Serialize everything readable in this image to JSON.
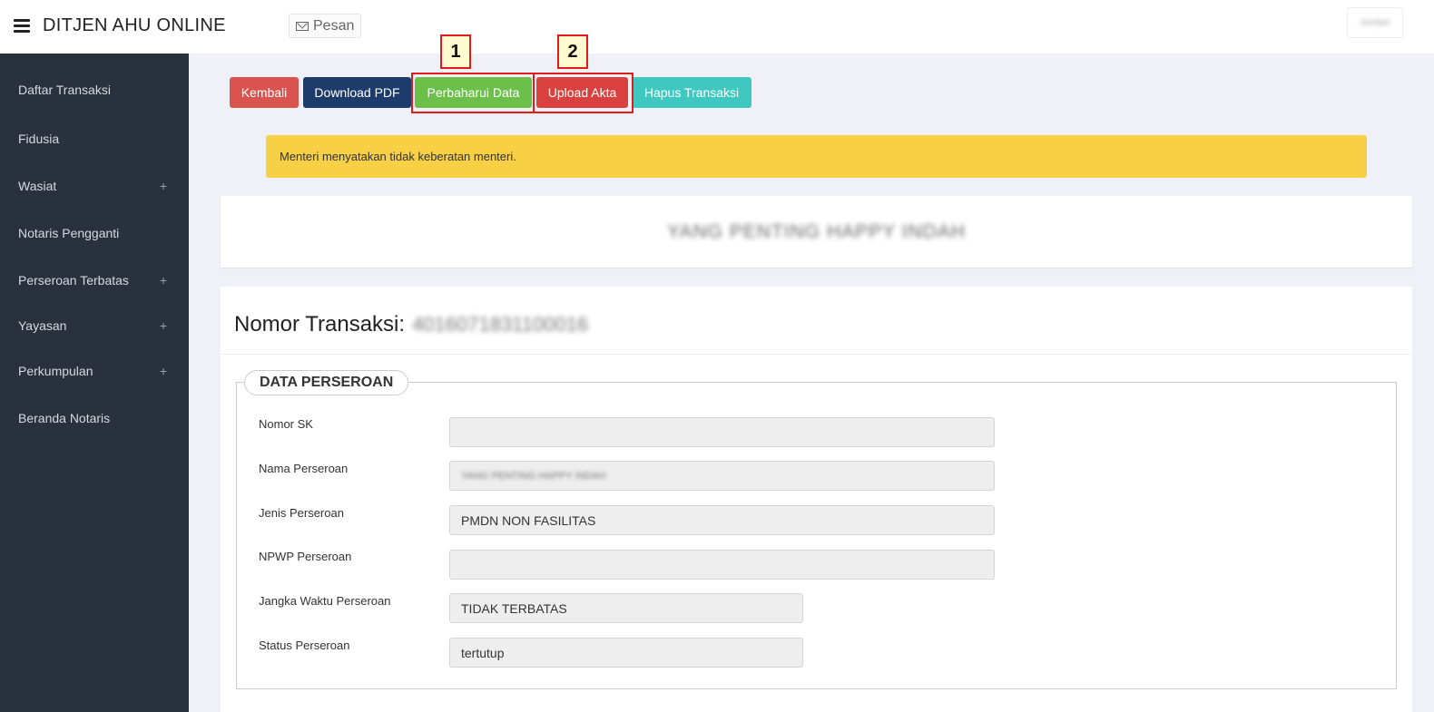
{
  "header": {
    "brand": "DITJEN AHU ONLINE",
    "pesan_label": "Pesan",
    "user_label": "Jordan"
  },
  "sidebar": {
    "items": [
      {
        "label": "Daftar Transaksi",
        "expandable": false
      },
      {
        "label": "Fidusia",
        "expandable": false
      },
      {
        "label": "Wasiat",
        "expandable": true
      },
      {
        "label": "Notaris Pengganti",
        "expandable": false
      },
      {
        "label": "Perseroan Terbatas",
        "expandable": true
      },
      {
        "label": "Yayasan",
        "expandable": true
      },
      {
        "label": "Perkumpulan",
        "expandable": true
      },
      {
        "label": "Beranda Notaris",
        "expandable": false
      }
    ],
    "expand_symbol": "+"
  },
  "toolbar": {
    "kembali": "Kembali",
    "download_pdf": "Download PDF",
    "perbaharui": "Perbaharui Data",
    "upload": "Upload Akta",
    "hapus": "Hapus Transaksi"
  },
  "callouts": {
    "one": "1",
    "two": "2"
  },
  "alert": {
    "message": "Menteri menyatakan tidak keberatan menteri."
  },
  "company": {
    "name": "YANG PENTING HAPPY INDAH"
  },
  "transaction": {
    "label": "Nomor Transaksi:",
    "number": "4016071831100016"
  },
  "data_perseroan": {
    "legend": "DATA PERSEROAN",
    "fields": [
      {
        "label": "Nomor SK",
        "value": ""
      },
      {
        "label": "Nama Perseroan",
        "value": "YANG PENTING HAPPY INDAH"
      },
      {
        "label": "Jenis Perseroan",
        "value": "PMDN NON FASILITAS"
      },
      {
        "label": "NPWP Perseroan",
        "value": ""
      },
      {
        "label": "Jangka Waktu Perseroan",
        "value": "TIDAK TERBATAS"
      },
      {
        "label": "Status Perseroan",
        "value": "tertutup"
      }
    ]
  },
  "colors": {
    "kembali": "#d9534f",
    "download_pdf": "#1d3c6b",
    "perbaharui": "#6cc04a",
    "upload": "#d9413f",
    "hapus": "#3fc8c0",
    "alert": "#f7d046",
    "sidebar": "#29323c",
    "highlight": "#e21b1b"
  }
}
